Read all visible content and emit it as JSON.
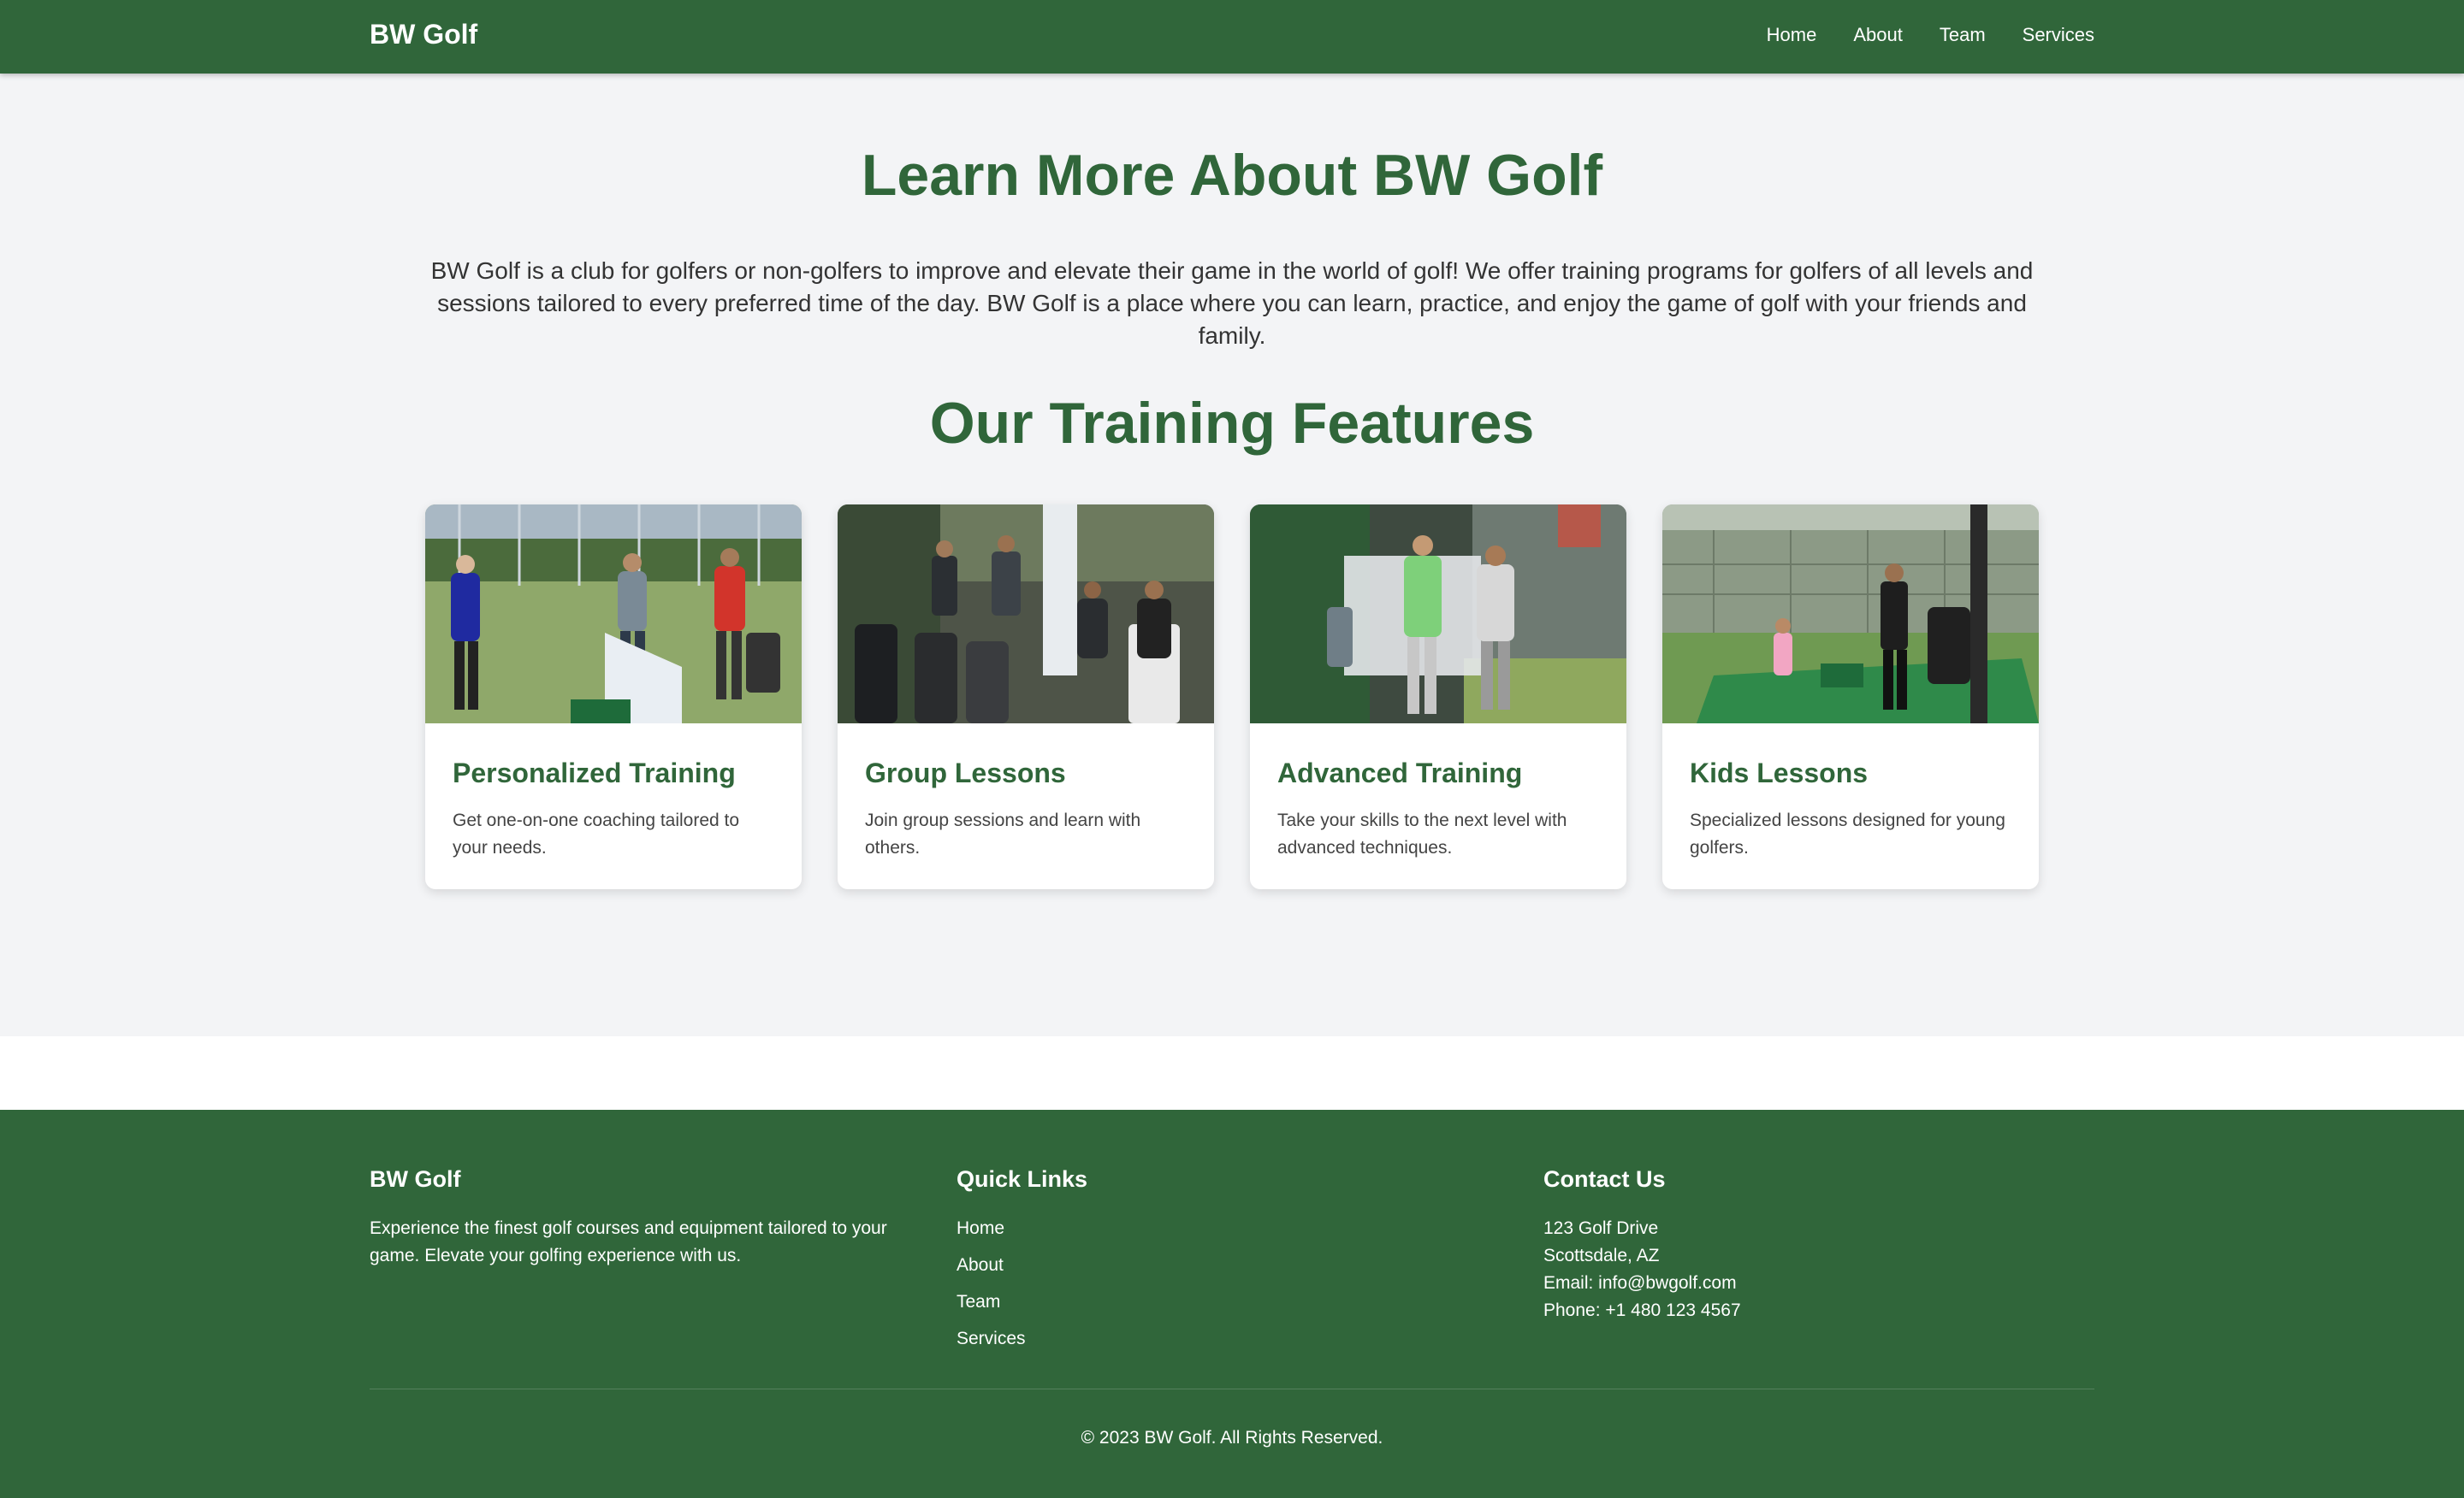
{
  "nav": {
    "brand": "BW Golf",
    "links": [
      "Home",
      "About",
      "Team",
      "Services"
    ]
  },
  "about": {
    "title": "Learn More About BW Golf",
    "text": "BW Golf is a club for golfers or non-golfers to improve and elevate their game in the world of golf! We offer training programs for golfers of all levels and sessions tailored to every preferred time of the day. BW Golf is a place where you can learn, practice, and enjoy the game of golf with your friends and family."
  },
  "features": {
    "title": "Our Training Features",
    "cards": [
      {
        "title": "Personalized Training",
        "desc": "Get one-on-one coaching tailored to your needs.",
        "photo": "golf-range-coaching-photo"
      },
      {
        "title": "Group Lessons",
        "desc": "Join group sessions and learn with others.",
        "photo": "golf-group-lesson-photo"
      },
      {
        "title": "Advanced Training",
        "desc": "Take your skills to the next level with advanced techniques.",
        "photo": "golf-advanced-training-photo"
      },
      {
        "title": "Kids Lessons",
        "desc": "Specialized lessons designed for young golfers.",
        "photo": "golf-kids-lesson-photo"
      }
    ]
  },
  "footer": {
    "about": {
      "title": "BW Golf",
      "text": "Experience the finest golf courses and equipment tailored to your game. Elevate your golfing experience with us."
    },
    "links": {
      "title": "Quick Links",
      "items": [
        "Home",
        "About",
        "Team",
        "Services"
      ]
    },
    "contact": {
      "title": "Contact Us",
      "address1": "123 Golf Drive",
      "address2": "Scottsdale, AZ",
      "email": "Email: info@bwgolf.com",
      "phone": "Phone: +1 480 123 4567"
    },
    "copyright": "© 2023 BW Golf. All Rights Reserved."
  },
  "colors": {
    "brand_green": "#30663a",
    "page_bg": "#f3f4f6"
  }
}
